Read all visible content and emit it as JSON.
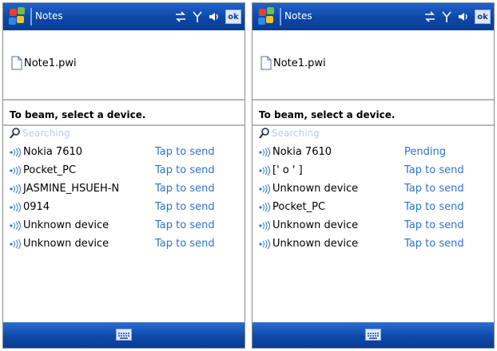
{
  "colors": {
    "titlebar": "#0d47a5",
    "link": "#2f72c6",
    "searching": "#b9cde8"
  },
  "screens": [
    {
      "app_title": "Notes",
      "ok_label": "ok",
      "file_name": "Note1.pwi",
      "instruction": "To beam, select a device.",
      "searching_text": "Searching",
      "devices": [
        {
          "name": "Nokia 7610",
          "action": "Tap to send"
        },
        {
          "name": "Pocket_PC",
          "action": "Tap to send"
        },
        {
          "name": "JASMINE_HSUEH-N",
          "action": "Tap to send"
        },
        {
          "name": "0914",
          "action": "Tap to send"
        },
        {
          "name": "Unknown device",
          "action": "Tap to send"
        },
        {
          "name": "Unknown device",
          "action": "Tap to send"
        }
      ]
    },
    {
      "app_title": "Notes",
      "ok_label": "ok",
      "file_name": "Note1.pwi",
      "instruction": "To beam, select a device.",
      "searching_text": "Searching",
      "devices": [
        {
          "name": "Nokia 7610",
          "action": "Pending"
        },
        {
          "name": "[' o ' ]",
          "action": "Tap to send"
        },
        {
          "name": "Unknown device",
          "action": "Tap to send"
        },
        {
          "name": "Pocket_PC",
          "action": "Tap to send"
        },
        {
          "name": "Unknown device",
          "action": "Tap to send"
        },
        {
          "name": "Unknown device",
          "action": "Tap to send"
        }
      ]
    }
  ]
}
